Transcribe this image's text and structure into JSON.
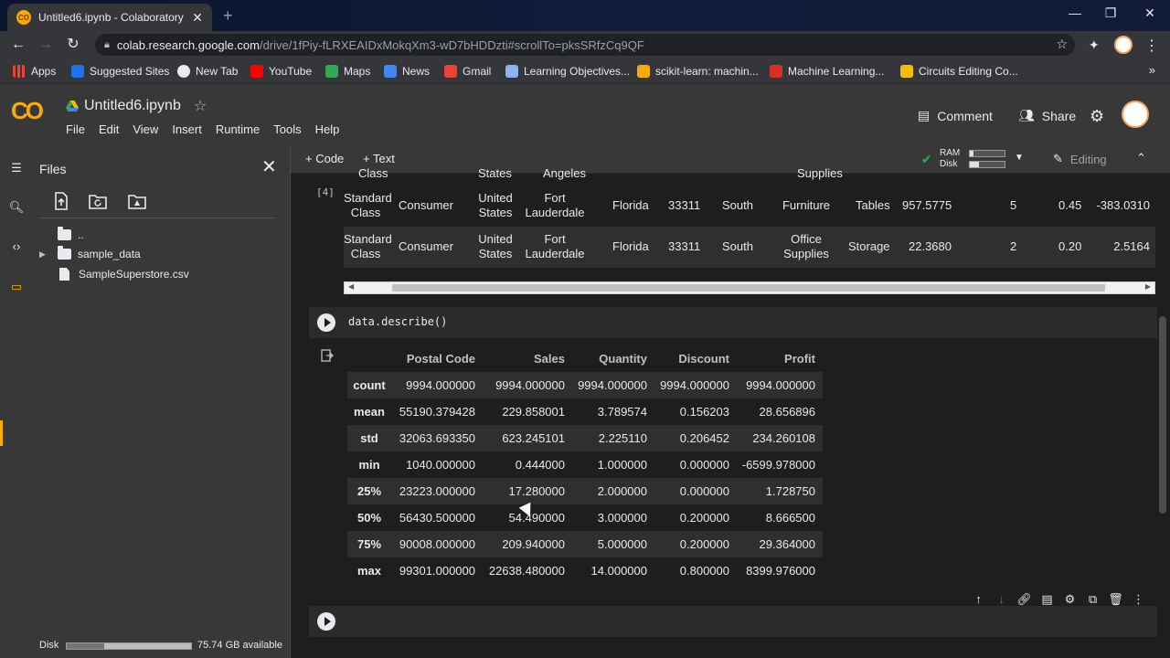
{
  "browser": {
    "tab_title": "Untitled6.ipynb - Colaboratory",
    "tab_favicon": "CO",
    "url_host": "colab.research.google.com",
    "url_path": "/drive/1fPiy-fLRXEAIDxMokqXm3-wD7bHDDzti#scrollTo=pksSRfzCq9QF",
    "bookmarks": [
      {
        "label": "Apps",
        "color": "#ea4335"
      },
      {
        "label": "Suggested Sites",
        "color": "#1a73e8"
      },
      {
        "label": "New Tab",
        "color": "#e8eaed"
      },
      {
        "label": "YouTube",
        "color": "#ff0000"
      },
      {
        "label": "Maps",
        "color": "#34a853"
      },
      {
        "label": "News",
        "color": "#4285f4"
      },
      {
        "label": "Gmail",
        "color": "#ea4335"
      },
      {
        "label": "Learning Objectives...",
        "color": "#8ab4f8"
      },
      {
        "label": "scikit-learn: machin...",
        "color": "#f9ab00"
      },
      {
        "label": "Machine Learning...",
        "color": "#d93025"
      },
      {
        "label": "Circuits Editing Co...",
        "color": "#fbbc04"
      }
    ],
    "more_bookmarks": "»"
  },
  "colab": {
    "logo": "CO",
    "notebook_title": "Untitled6.ipynb",
    "menu": [
      "File",
      "Edit",
      "View",
      "Insert",
      "Runtime",
      "Tools",
      "Help"
    ],
    "comment_label": "Comment",
    "share_label": "Share"
  },
  "files_panel": {
    "title": "Files",
    "tree": [
      {
        "name": "..",
        "type": "parent"
      },
      {
        "name": "sample_data",
        "type": "folder"
      },
      {
        "name": "SampleSuperstore.csv",
        "type": "file"
      }
    ],
    "disk_label": "Disk",
    "disk_used_fraction": 0.3,
    "disk_available": "75.74 GB available"
  },
  "toolbar": {
    "code_label": "+ Code",
    "text_label": "+ Text",
    "ram_label": "RAM",
    "disk_label": "Disk",
    "ram_used_fraction": 0.1,
    "disk_used_fraction": 0.25,
    "editing_label": "Editing"
  },
  "prev_output": {
    "exec_count": "[4]",
    "partial_top": [
      "Class",
      "States",
      "Angeles",
      "Supplies"
    ],
    "rows": [
      {
        "ship_mode": "Standard Class",
        "segment": "Consumer",
        "country": "United States",
        "city": "Fort Lauderdale",
        "state": "Florida",
        "postal": "33311",
        "region": "South",
        "category": "Furniture",
        "sub_category": "Tables",
        "sales": "957.5775",
        "quantity": "5",
        "discount": "0.45",
        "profit": "-383.0310"
      },
      {
        "ship_mode": "Standard Class",
        "segment": "Consumer",
        "country": "United States",
        "city": "Fort Lauderdale",
        "state": "Florida",
        "postal": "33311",
        "region": "South",
        "category": "Office Supplies",
        "sub_category": "Storage",
        "sales": "22.3680",
        "quantity": "2",
        "discount": "0.20",
        "profit": "2.5164"
      }
    ]
  },
  "describe_cell": {
    "code": "data.describe()",
    "columns": [
      "Postal Code",
      "Sales",
      "Quantity",
      "Discount",
      "Profit"
    ],
    "rows": [
      {
        "index": "count",
        "values": [
          "9994.000000",
          "9994.000000",
          "9994.000000",
          "9994.000000",
          "9994.000000"
        ]
      },
      {
        "index": "mean",
        "values": [
          "55190.379428",
          "229.858001",
          "3.789574",
          "0.156203",
          "28.656896"
        ]
      },
      {
        "index": "std",
        "values": [
          "32063.693350",
          "623.245101",
          "2.225110",
          "0.206452",
          "234.260108"
        ]
      },
      {
        "index": "min",
        "values": [
          "1040.000000",
          "0.444000",
          "1.000000",
          "0.000000",
          "-6599.978000"
        ]
      },
      {
        "index": "25%",
        "values": [
          "23223.000000",
          "17.280000",
          "2.000000",
          "0.000000",
          "1.728750"
        ]
      },
      {
        "index": "50%",
        "values": [
          "56430.500000",
          "54.490000",
          "3.000000",
          "0.200000",
          "8.666500"
        ]
      },
      {
        "index": "75%",
        "values": [
          "90008.000000",
          "209.940000",
          "5.000000",
          "0.200000",
          "29.364000"
        ]
      },
      {
        "index": "max",
        "values": [
          "99301.000000",
          "22638.480000",
          "14.000000",
          "0.800000",
          "8399.976000"
        ]
      }
    ]
  }
}
